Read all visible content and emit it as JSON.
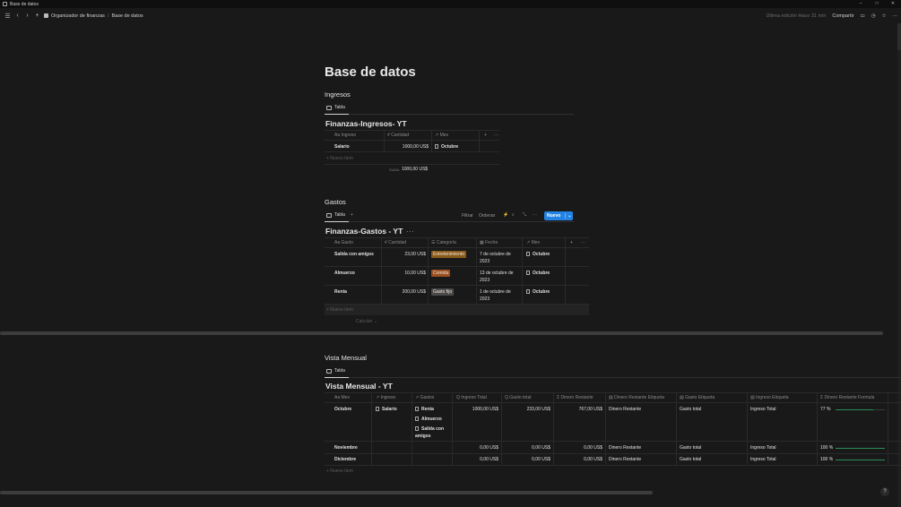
{
  "window": {
    "title": "Base de datos",
    "controls": [
      "–",
      "□",
      "✕"
    ]
  },
  "topbar": {
    "breadcrumb": [
      "Organizador de finanzas",
      "/",
      "Base de datos"
    ],
    "last_edit": "Última edición Hace 31 min",
    "share": "Compartir"
  },
  "page": {
    "title": "Base de datos"
  },
  "ingresos": {
    "section": "Ingresos",
    "tab": "Tabla",
    "db_title": "Finanzas-Ingresos- YT",
    "columns": [
      "Aa Ingreso",
      "# Cantidad",
      "↗ Mes"
    ],
    "rows": [
      {
        "name": "Salario",
        "amount": "1000,00 US$",
        "mes": "Octubre"
      }
    ],
    "new_item": "+ Nuevo ítem",
    "sum_label": "SUMA",
    "sum_value": "1000,00 US$"
  },
  "gastos": {
    "section": "Gastos",
    "tab": "Tabla",
    "toolbar": {
      "filter": "Filtrar",
      "sort": "Ordenar",
      "new": "Nuevo"
    },
    "db_title": "Finanzas-Gastos - YT",
    "columns": [
      "Aa Gasto",
      "# Cantidad",
      "☰ Categoría",
      "▦ Fecha",
      "↗ Mes"
    ],
    "rows": [
      {
        "name": "Salida con amigos",
        "amount": "23,00 US$",
        "cat": "Entretenimiento",
        "date1": "7 de octubre de",
        "date2": "2023",
        "mes": "Octubre"
      },
      {
        "name": "Almuerzo",
        "amount": "10,00 US$",
        "cat": "Comida",
        "date1": "13 de octubre de",
        "date2": "2023",
        "mes": "Octubre"
      },
      {
        "name": "Renta",
        "amount": "200,00 US$",
        "cat": "Gasto fijo",
        "date1": "1 de octubre de",
        "date2": "2023",
        "mes": "Octubre"
      }
    ],
    "new_item": "+ Nuevo ítem",
    "calc": "Calcular ⌄"
  },
  "mensual": {
    "section": "Vista Mensual",
    "tab": "Tabla",
    "db_title": "Vista Mensual - YT",
    "columns": [
      "Aa Mes",
      "↗ Ingreso",
      "↗ Gastos",
      "Q Ingreso Total",
      "Q Gasto total",
      "Σ Dinero Restante",
      "▤ Dinero Restante Etiqueta",
      "▤ Gasto Etiqueta",
      "▤ Ingreso Etiqueta",
      "Σ Dinero Restante Formula"
    ],
    "rows": [
      {
        "mes": "Octubre",
        "ingreso": "Salario",
        "gastos": [
          "Renta",
          "Almuerzo",
          "Salida con",
          "amigos"
        ],
        "it": "1000,00 US$",
        "gt": "233,00 US$",
        "dr": "767,00 US$",
        "dre": "Dinero Restante",
        "ge": "Gasto total",
        "ie": "Ingreso Total",
        "pct": "77 %",
        "pctv": 0.77
      },
      {
        "mes": "Noviembre",
        "ingreso": "",
        "gastos": [],
        "it": "0,00 US$",
        "gt": "0,00 US$",
        "dr": "0,00 US$",
        "dre": "Dinero Restante",
        "ge": "Gasto total",
        "ie": "Ingreso Total",
        "pct": "100 %",
        "pctv": 1.0
      },
      {
        "mes": "Diciembre",
        "ingreso": "",
        "gastos": [],
        "it": "0,00 US$",
        "gt": "0,00 US$",
        "dr": "0,00 US$",
        "dre": "Dinero Restante",
        "ge": "Gasto total",
        "ie": "Ingreso Total",
        "pct": "100 %",
        "pctv": 1.0
      }
    ],
    "new_item": "+ Nuevo ítem"
  },
  "colors": {
    "accent": "#2383e2",
    "tag_entretenimiento": "#8a5a1c",
    "tag_comida": "#9a4f1f",
    "tag_gasto_fijo": "#4a4a4a",
    "progress": "#2b8c57"
  },
  "help": "?"
}
